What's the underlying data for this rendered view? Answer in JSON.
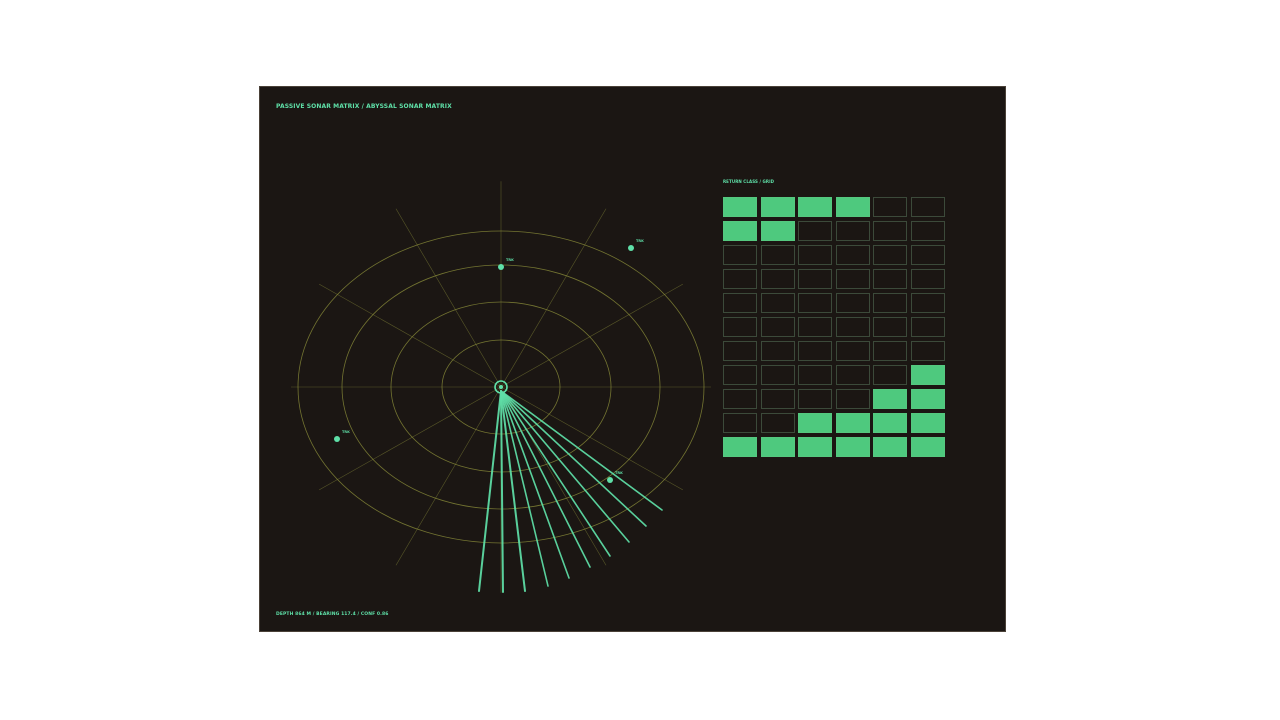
{
  "panel": {
    "title": "PASSIVE SONAR MATRIX / ABYSSAL SONAR MATRIX",
    "footer": "DEPTH 864 M / BEARING 117.4 / CONF 0.86"
  },
  "grid": {
    "label": "RETURN CLASS / GRID",
    "rows": [
      [
        1,
        1,
        1,
        1,
        0,
        0
      ],
      [
        1,
        1,
        0,
        0,
        0,
        0
      ],
      [
        0,
        0,
        0,
        0,
        0,
        0
      ],
      [
        0,
        0,
        0,
        0,
        0,
        0
      ],
      [
        0,
        0,
        0,
        0,
        0,
        0
      ],
      [
        0,
        0,
        0,
        0,
        0,
        0
      ],
      [
        0,
        0,
        0,
        0,
        0,
        0
      ],
      [
        0,
        0,
        0,
        0,
        0,
        1
      ],
      [
        0,
        0,
        0,
        0,
        1,
        1
      ],
      [
        0,
        0,
        1,
        1,
        1,
        1
      ],
      [
        1,
        1,
        1,
        1,
        1,
        1
      ]
    ]
  },
  "contacts": [
    {
      "label": "TRK",
      "bearing_deg": 0
    },
    {
      "label": "TRK",
      "bearing_deg": 38
    },
    {
      "label": "TRK",
      "bearing_deg": 254
    },
    {
      "label": "TRK",
      "bearing_deg": 128
    }
  ],
  "colors": {
    "accent": "#5fe0a8",
    "ring": "#8a8c3a",
    "cell_on": "#4ec97e",
    "panel_bg": "#1b1613"
  }
}
